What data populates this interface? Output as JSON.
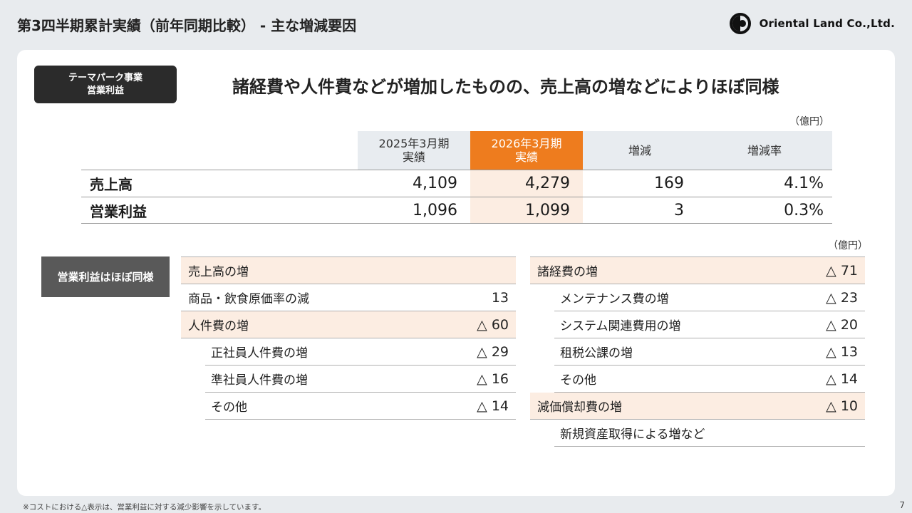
{
  "header": {
    "title": "第3四半期累計実績（前年同期比較） - 主な増減要因",
    "company": "Oriental Land Co.,Ltd."
  },
  "badge": {
    "line1": "テーマパーク事業",
    "line2": "営業利益"
  },
  "headline": "諸経費や人件費などが増加したものの、売上高の増などによりほぼ同様",
  "unit": "（億円）",
  "summary": {
    "headers": {
      "prev_line1": "2025年3月期",
      "prev_line2": "実績",
      "curr_line1": "2026年3月期",
      "curr_line2": "実績",
      "diff": "増減",
      "rate": "増減率"
    },
    "rows": [
      {
        "label": "売上高",
        "prev": "4,109",
        "curr": "4,279",
        "diff": "169",
        "rate": "4.1%"
      },
      {
        "label": "営業利益",
        "prev": "1,096",
        "curr": "1,099",
        "diff": "3",
        "rate": "0.3%"
      }
    ]
  },
  "side_label": "営業利益はほぼ同様",
  "left_factors": [
    {
      "label": "売上高の増",
      "value": ""
    },
    {
      "label": "商品・飲食原価率の減",
      "value": "13"
    },
    {
      "label": "人件費の増",
      "value": "△ 60"
    },
    {
      "label": "正社員人件費の増",
      "value": "△ 29"
    },
    {
      "label": "準社員人件費の増",
      "value": "△ 16"
    },
    {
      "label": "その他",
      "value": "△ 14"
    }
  ],
  "right_factors": [
    {
      "label": "諸経費の増",
      "value": "△ 71"
    },
    {
      "label": "メンテナンス費の増",
      "value": "△ 23"
    },
    {
      "label": "システム関連費用の増",
      "value": "△ 20"
    },
    {
      "label": "租税公課の増",
      "value": "△ 13"
    },
    {
      "label": "その他",
      "value": "△ 14"
    },
    {
      "label": "減価償却費の増",
      "value": "△ 10"
    },
    {
      "label": "新規資産取得による増など",
      "value": ""
    }
  ],
  "footnote": "※コストにおける△表示は、営業利益に対する減少影響を示しています。",
  "page_number": "7"
}
